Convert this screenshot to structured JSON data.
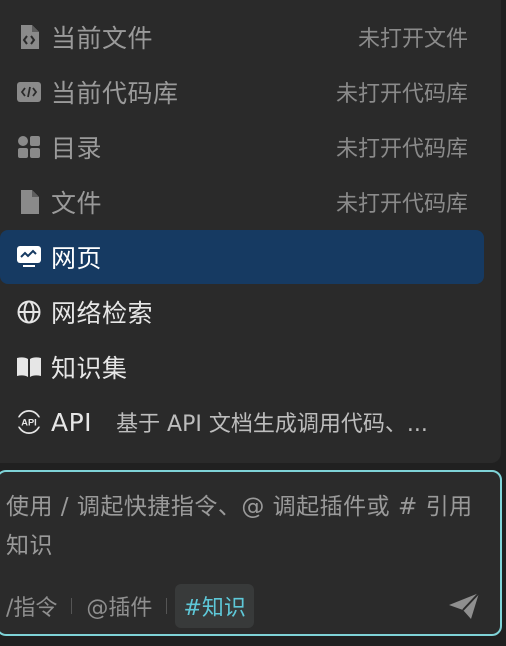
{
  "menu": {
    "items": [
      {
        "icon": "file-code-icon",
        "label": "当前文件",
        "hint": "未打开文件"
      },
      {
        "icon": "code-repo-icon",
        "label": "当前代码库",
        "hint": "未打开代码库"
      },
      {
        "icon": "catalog-icon",
        "label": "目录",
        "hint": "未打开代码库"
      },
      {
        "icon": "file-icon",
        "label": "文件",
        "hint": "未打开代码库"
      },
      {
        "icon": "webpage-icon",
        "label": "网页"
      },
      {
        "icon": "globe-icon",
        "label": "网络检索"
      },
      {
        "icon": "book-icon",
        "label": "知识集"
      },
      {
        "icon": "api-icon",
        "label": "API",
        "desc": "基于 API 文档生成调用代码、..."
      }
    ]
  },
  "input": {
    "placeholder": "使用 / 调起快捷指令、@ 调起插件或 # 引用知识"
  },
  "toolbar": {
    "command": "/指令",
    "plugin": "@插件",
    "knowledge": "#知识"
  },
  "colors": {
    "active_item_bg": "#163a62",
    "input_border": "#7fd3d7",
    "knowledge_accent": "#5ec8d8"
  }
}
